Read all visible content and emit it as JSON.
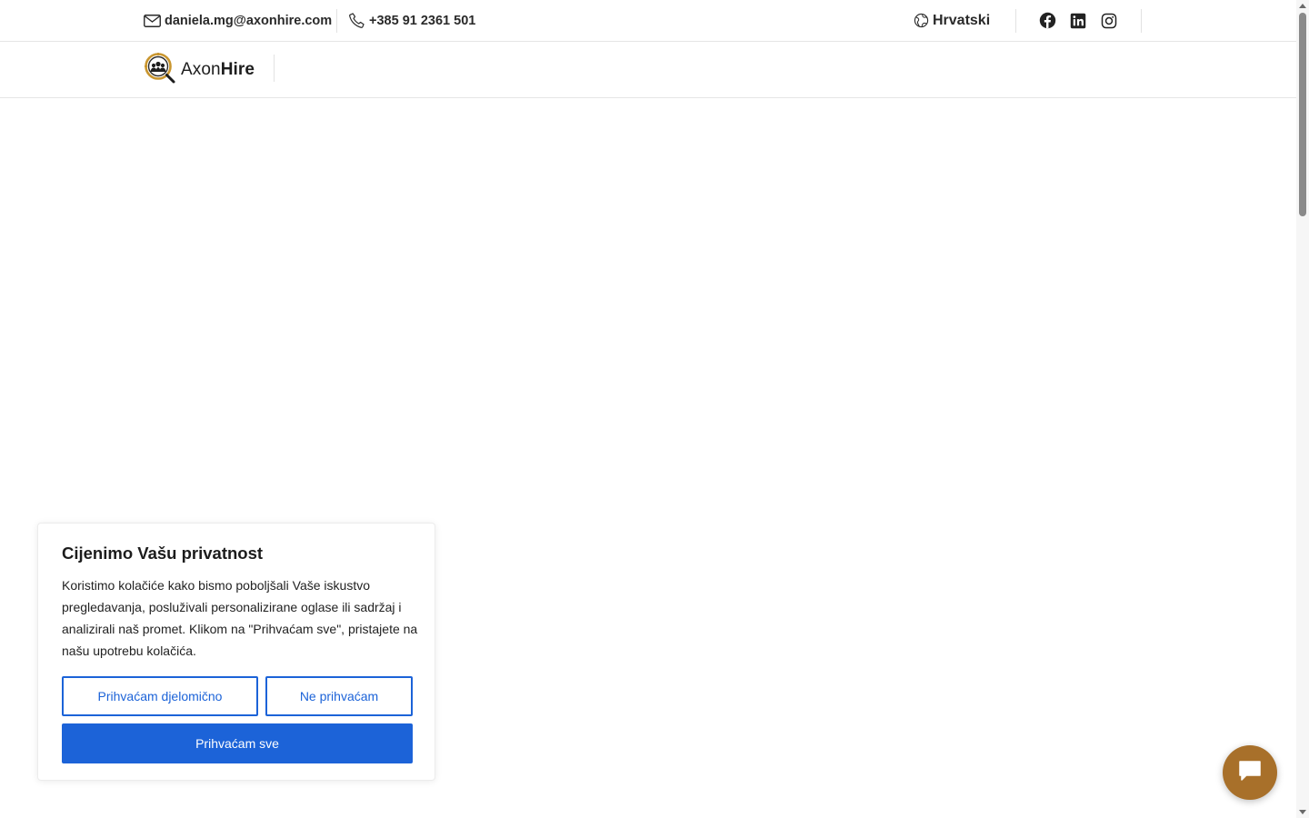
{
  "topbar": {
    "email": "daniela.mg@axonhire.com",
    "phone": "+385 91 2361 501",
    "language": "Hrvatski",
    "icons": {
      "email": "mail-icon",
      "phone": "phone-icon",
      "language": "globe-icon",
      "social": [
        "facebook-icon",
        "linkedin-icon",
        "instagram-icon"
      ]
    }
  },
  "header": {
    "logo": {
      "part1": "Axon",
      "part2": "Hire",
      "icon": "magnifier-team-logo"
    }
  },
  "cookie_banner": {
    "title": "Cijenimo Vašu privatnost",
    "text": "Koristimo kolačiće kako bismo poboljšali Vaše iskustvo pregledavanja, posluživali personalizirane oglase ili sadržaj i analizirali naš promet. Klikom na \"Prihvaćam sve\", pristajete na našu upotrebu kolačića.",
    "buttons": {
      "partial": "Prihvaćam djelomično",
      "reject": "Ne prihvaćam",
      "accept_all": "Prihvaćam sve"
    }
  },
  "chat_widget": {
    "icon": "chat-bubble-icon"
  },
  "colors": {
    "primary": "#1c63d8",
    "chat": "#a8702a",
    "logo_gold": "#c9962f"
  }
}
